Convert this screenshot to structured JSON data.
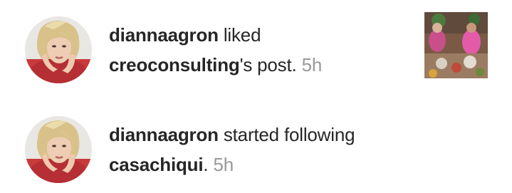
{
  "notifications": [
    {
      "actor": "diannaagron",
      "action": "liked",
      "target": "creoconsulting",
      "suffix": "'s post.",
      "time": "5h",
      "avatar_icon": "profile-photo",
      "has_post_thumbnail": true
    },
    {
      "actor": "diannaagron",
      "action": "started following",
      "target": "casachiqui",
      "suffix": ".",
      "time": "5h",
      "avatar_icon": "profile-photo",
      "has_post_thumbnail": false
    }
  ],
  "colors": {
    "text": "#262626",
    "timestamp": "#999999",
    "background": "#ffffff"
  }
}
